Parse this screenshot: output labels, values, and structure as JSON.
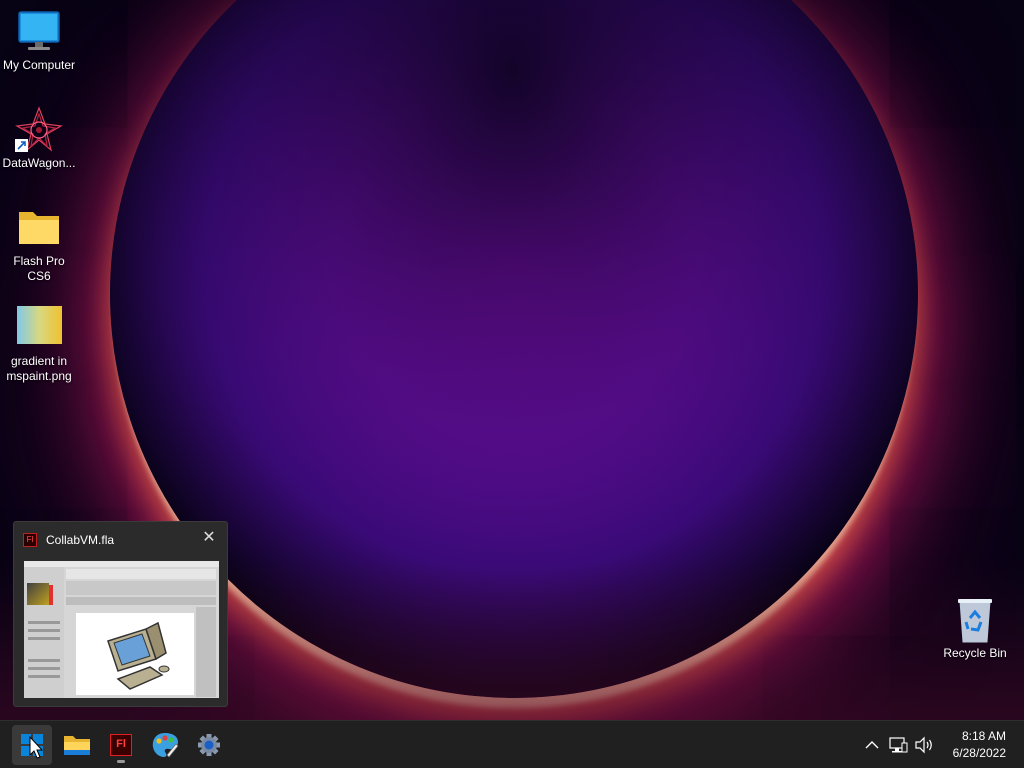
{
  "desktop": {
    "icons": [
      {
        "label": "My Computer",
        "icon": "monitor-icon"
      },
      {
        "label": "DataWagon...",
        "icon": "datawagon-shortcut-icon"
      },
      {
        "label": "Flash Pro CS6",
        "icon": "folder-icon"
      },
      {
        "label": "gradient in\nmspaint.png",
        "label_line1": "gradient in",
        "label_line2": "mspaint.png",
        "icon": "image-file-icon"
      },
      {
        "label": "Recycle Bin",
        "icon": "recycle-bin-icon"
      }
    ]
  },
  "preview": {
    "title": "CollabVM.fla",
    "app_badge": "Fl",
    "close_glyph": "✕"
  },
  "taskbar": {
    "buttons": [
      {
        "name": "start",
        "icon": "windows-start-icon",
        "active": true
      },
      {
        "name": "file-explorer",
        "icon": "folder-icon"
      },
      {
        "name": "flash-pro",
        "icon": "flash-pro-icon",
        "badge": "Fl",
        "running": true
      },
      {
        "name": "paint",
        "icon": "paint-palette-icon"
      },
      {
        "name": "settings",
        "icon": "gear-icon"
      }
    ],
    "tray": {
      "overflow_icon": "chevron-up-icon",
      "network_icon": "network-icon",
      "volume_icon": "volume-icon",
      "time": "8:18 AM",
      "date": "6/28/2022"
    }
  },
  "colors": {
    "taskbar_bg": "#202020",
    "accent": "#0a84d8",
    "wallpaper_core": "#8c10c8",
    "wallpaper_rim": "#ff7a3c"
  }
}
